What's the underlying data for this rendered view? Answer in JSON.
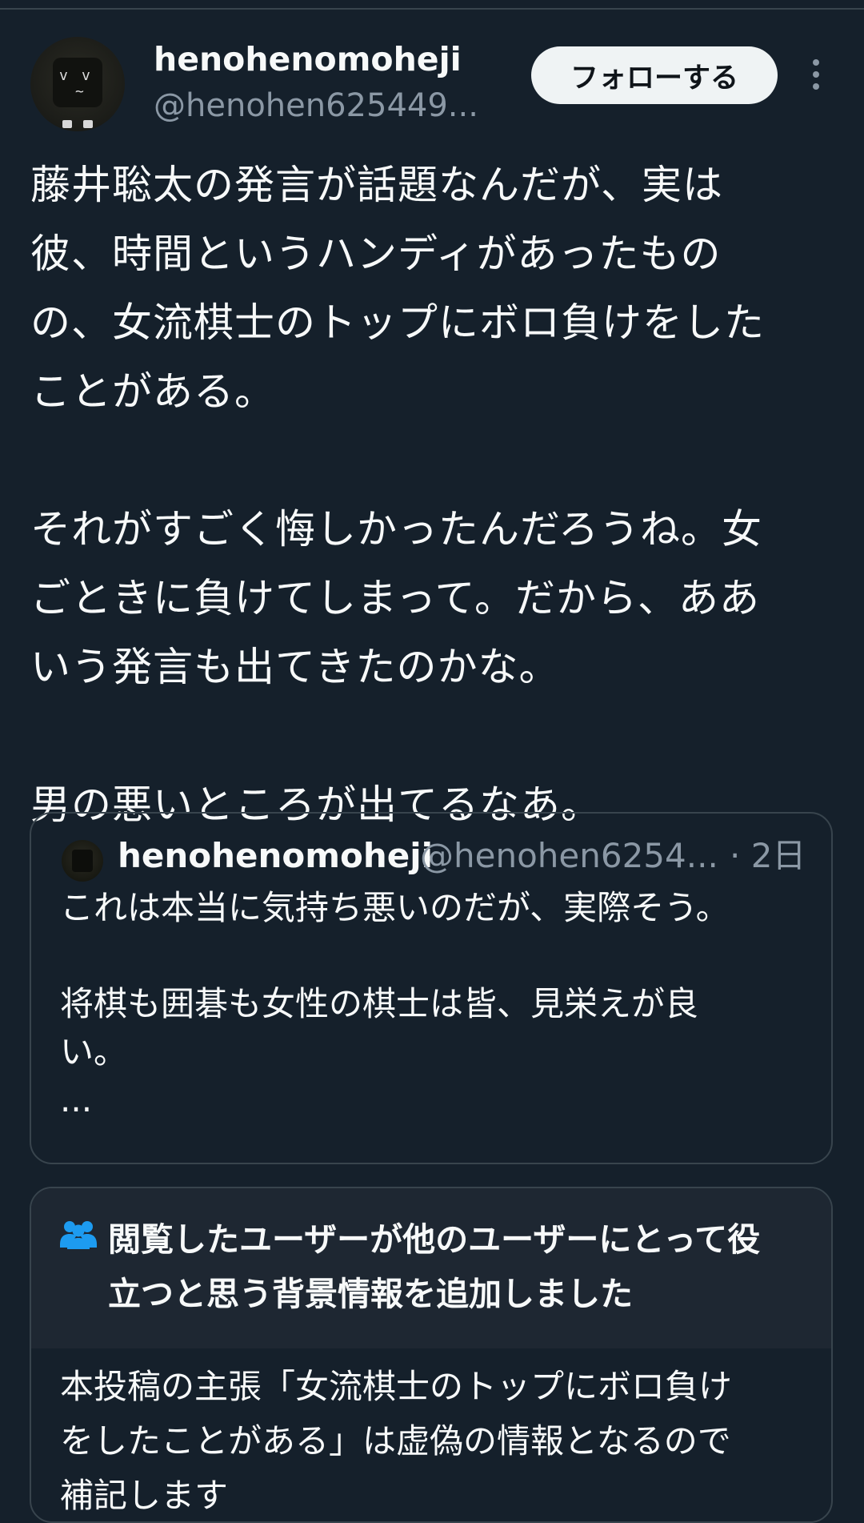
{
  "tweet": {
    "author": {
      "display_name": "henohenomoheji",
      "handle": "@henohen625449..."
    },
    "follow_label": "フォローする",
    "more_icon": "more-vertical-icon",
    "text": "藤井聡太の発言が話題なんだが、実は\n彼、時間というハンディがあったもの\nの、女流棋士のトップにボロ負けをした\nことがある。\n\nそれがすごく悔しかったんだろうね。女\nごときに負けてしまって。だから、ああ\nいう発言も出てきたのかな。\n\n男の悪いところが出てるなあ。"
  },
  "quoted_tweet": {
    "display_name": "henohenomoheji",
    "handle": "@henohen6254...",
    "time": "· 2日",
    "text": "これは本当に気持ち悪いのだが、実際そう。\n\n将棋も囲碁も女性の棋士は皆、見栄えが良\nい。\n..."
  },
  "community_note": {
    "icon": "people-icon",
    "icon_color": "#1d9bf0",
    "title": "閲覧したユーザーが他のユーザーにとって役\n立つと思う背景情報を追加しました",
    "body": "本投稿の主張「女流棋士のトップにボロ負け\nをしたことがある」は虚偽の情報となるので\n補記します"
  },
  "colors": {
    "background": "#15202b",
    "text": "#f7f9f9",
    "secondary_text": "#8b98a5",
    "border": "#38444d",
    "follow_button_bg": "#eff3f4"
  }
}
